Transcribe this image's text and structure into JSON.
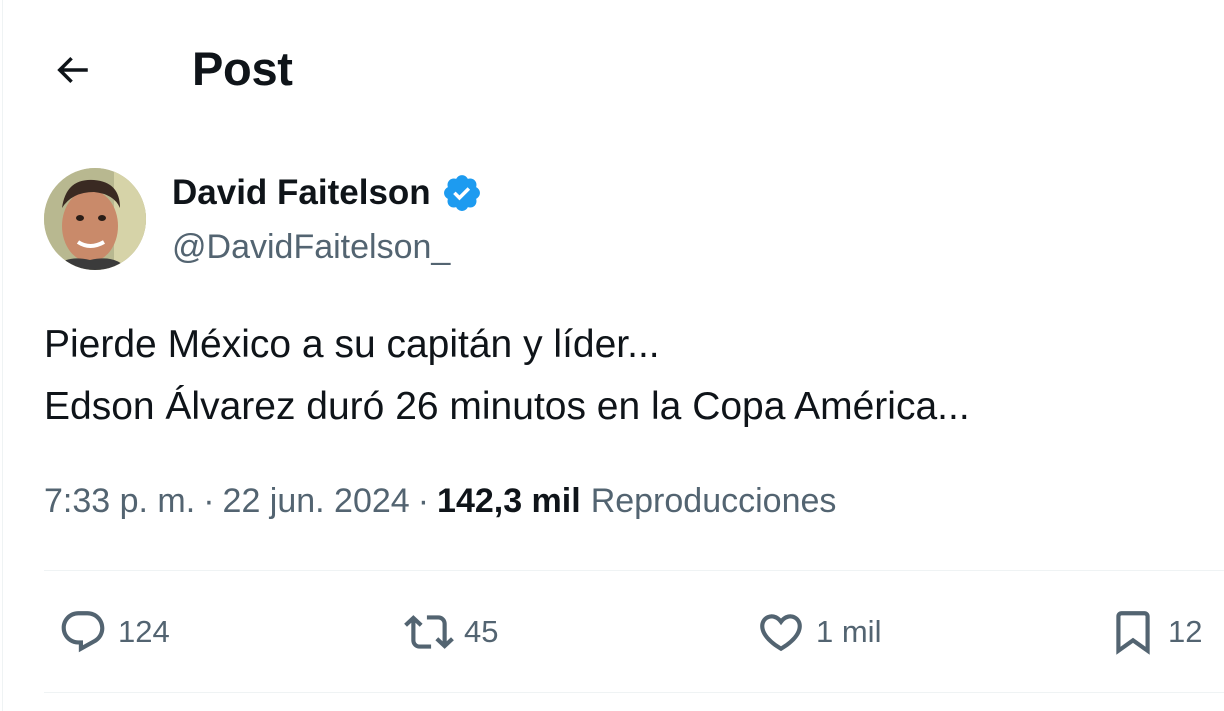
{
  "header": {
    "title": "Post",
    "back_icon": "arrow-left-icon"
  },
  "author": {
    "name": "David Faitelson",
    "handle": "@DavidFaitelson_",
    "verified": true,
    "verified_color": "#1d9bf0"
  },
  "post": {
    "lines": [
      "Pierde México a su capitán y líder...",
      "Edson Álvarez duró 26 minutos en la Copa América..."
    ],
    "time": "7:33 p. m.",
    "separator": "·",
    "date": "22 jun. 2024",
    "views_count": "142,3 mil",
    "views_label": "Reproducciones"
  },
  "actions": {
    "replies": {
      "icon": "reply-icon",
      "count": "124"
    },
    "reposts": {
      "icon": "repost-icon",
      "count": "45"
    },
    "likes": {
      "icon": "heart-icon",
      "count": "1 mil"
    },
    "bookmarks": {
      "icon": "bookmark-icon",
      "count": "12"
    }
  },
  "colors": {
    "text_primary": "#0f1419",
    "text_secondary": "#536471",
    "divider": "#eff3f4",
    "accent": "#1d9bf0"
  }
}
